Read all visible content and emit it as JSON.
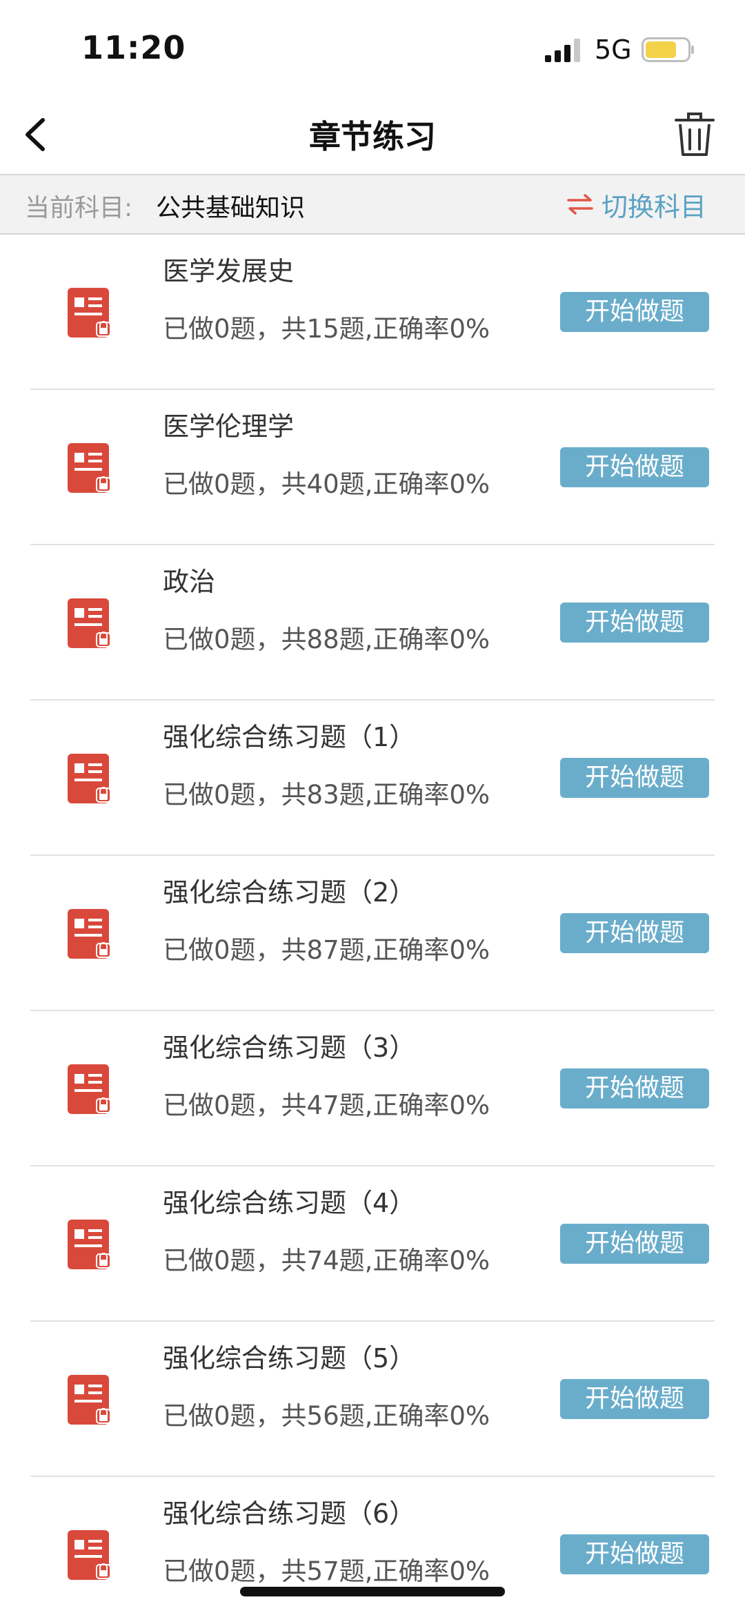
{
  "status_bar": {
    "time": "11:20",
    "network": "5G"
  },
  "nav": {
    "title": "章节练习"
  },
  "subject_bar": {
    "label": "当前科目:",
    "value": "公共基础知识",
    "switch_label": "切换科目"
  },
  "chapters": [
    {
      "name": "医学发展史",
      "stats": "已做0题，共15题,正确率0%",
      "button": "开始做题"
    },
    {
      "name": "医学伦理学",
      "stats": "已做0题，共40题,正确率0%",
      "button": "开始做题"
    },
    {
      "name": "政治",
      "stats": "已做0题，共88题,正确率0%",
      "button": "开始做题"
    },
    {
      "name": "强化综合练习题（1）",
      "stats": "已做0题，共83题,正确率0%",
      "button": "开始做题"
    },
    {
      "name": "强化综合练习题（2）",
      "stats": "已做0题，共87题,正确率0%",
      "button": "开始做题"
    },
    {
      "name": "强化综合练习题（3）",
      "stats": "已做0题，共47题,正确率0%",
      "button": "开始做题"
    },
    {
      "name": "强化综合练习题（4）",
      "stats": "已做0题，共74题,正确率0%",
      "button": "开始做题"
    },
    {
      "name": "强化综合练习题（5）",
      "stats": "已做0题，共56题,正确率0%",
      "button": "开始做题"
    },
    {
      "name": "强化综合练习题（6）",
      "stats": "已做0题，共57题,正确率0%",
      "button": "开始做题"
    }
  ],
  "colors": {
    "accent": "#6aadcb",
    "icon_red": "#d9493b",
    "swap_red": "#e0574a"
  }
}
